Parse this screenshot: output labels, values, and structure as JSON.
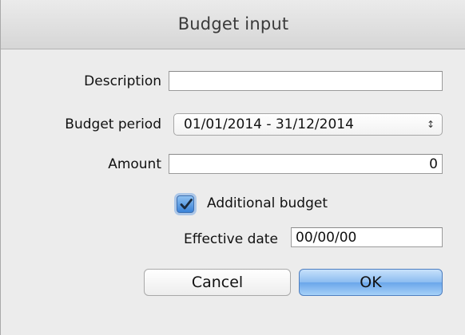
{
  "window": {
    "title": "Budget input"
  },
  "form": {
    "description": {
      "label": "Description",
      "value": ""
    },
    "budget_period": {
      "label": "Budget period",
      "selected": "01/01/2014 - 31/12/2014",
      "arrows": "↕"
    },
    "amount": {
      "label": "Amount",
      "value": "0"
    },
    "additional_budget": {
      "label": "Additional budget",
      "checked": true
    },
    "effective_date": {
      "label": "Effective date",
      "value": "00/00/00"
    }
  },
  "buttons": {
    "cancel_label": "Cancel",
    "ok_label": "OK"
  },
  "colors": {
    "accent": "#3a82d8",
    "window_bg": "#ececec"
  }
}
